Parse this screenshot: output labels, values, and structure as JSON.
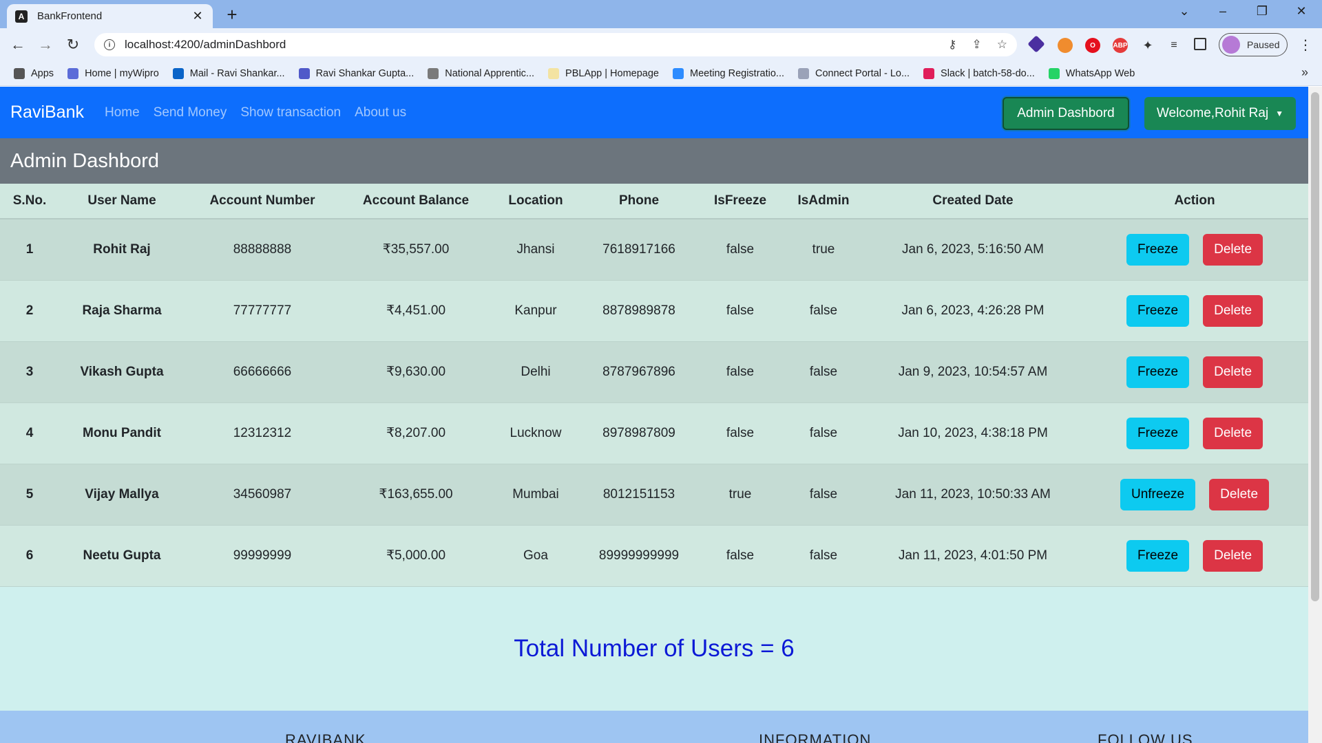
{
  "browser": {
    "tab_title": "BankFrontend",
    "tab_favicon": "A",
    "url": "localhost:4200/adminDashbord",
    "profile_status": "Paused",
    "bookmarks": [
      {
        "label": "Apps",
        "icon": "apps-grid-icon",
        "color": "#555555"
      },
      {
        "label": "Home | myWipro",
        "icon": "wipro-icon",
        "color": "#5b6cd8"
      },
      {
        "label": "Mail - Ravi Shankar...",
        "icon": "outlook-icon",
        "color": "#0a64c8"
      },
      {
        "label": "Ravi Shankar Gupta...",
        "icon": "teams-icon",
        "color": "#5059c9"
      },
      {
        "label": "National Apprentic...",
        "icon": "apprentice-icon",
        "color": "#7a7a7a"
      },
      {
        "label": "PBLApp | Homepage",
        "icon": "pbl-icon",
        "color": "#f3e3a2"
      },
      {
        "label": "Meeting Registratio...",
        "icon": "zoom-icon",
        "color": "#2d8cff"
      },
      {
        "label": "Connect Portal - Lo...",
        "icon": "wipro-icon",
        "color": "#9aa2b8"
      },
      {
        "label": "Slack | batch-58-do...",
        "icon": "slack-icon",
        "color": "#e01e5a"
      },
      {
        "label": "WhatsApp Web",
        "icon": "whatsapp-icon",
        "color": "#25d366"
      }
    ]
  },
  "navbar": {
    "brand": "RaviBank",
    "links": [
      "Home",
      "Send Money",
      "Show transaction",
      "About us"
    ],
    "admin_button": "Admin Dashbord",
    "welcome_button": "Welcome,Rohit Raj"
  },
  "dashboard": {
    "title": "Admin Dashbord",
    "columns": [
      "S.No.",
      "User Name",
      "Account Number",
      "Account Balance",
      "Location",
      "Phone",
      "IsFreeze",
      "IsAdmin",
      "Created Date",
      "Action"
    ],
    "rows": [
      {
        "sno": "1",
        "name": "Rohit Raj",
        "account": "88888888",
        "balance": "₹35,557.00",
        "location": "Jhansi",
        "phone": "7618917166",
        "is_freeze": "false",
        "is_admin": "true",
        "created": "Jan 6, 2023, 5:16:50 AM",
        "freeze_label": "Freeze",
        "delete_label": "Delete"
      },
      {
        "sno": "2",
        "name": "Raja Sharma",
        "account": "77777777",
        "balance": "₹4,451.00",
        "location": "Kanpur",
        "phone": "8878989878",
        "is_freeze": "false",
        "is_admin": "false",
        "created": "Jan 6, 2023, 4:26:28 PM",
        "freeze_label": "Freeze",
        "delete_label": "Delete"
      },
      {
        "sno": "3",
        "name": "Vikash Gupta",
        "account": "66666666",
        "balance": "₹9,630.00",
        "location": "Delhi",
        "phone": "8787967896",
        "is_freeze": "false",
        "is_admin": "false",
        "created": "Jan 9, 2023, 10:54:57 AM",
        "freeze_label": "Freeze",
        "delete_label": "Delete"
      },
      {
        "sno": "4",
        "name": "Monu Pandit",
        "account": "12312312",
        "balance": "₹8,207.00",
        "location": "Lucknow",
        "phone": "8978987809",
        "is_freeze": "false",
        "is_admin": "false",
        "created": "Jan 10, 2023, 4:38:18 PM",
        "freeze_label": "Freeze",
        "delete_label": "Delete"
      },
      {
        "sno": "5",
        "name": "Vijay Mallya",
        "account": "34560987",
        "balance": "₹163,655.00",
        "location": "Mumbai",
        "phone": "8012151153",
        "is_freeze": "true",
        "is_admin": "false",
        "created": "Jan 11, 2023, 10:50:33 AM",
        "freeze_label": "Unfreeze",
        "delete_label": "Delete"
      },
      {
        "sno": "6",
        "name": "Neetu Gupta",
        "account": "99999999",
        "balance": "₹5,000.00",
        "location": "Goa",
        "phone": "89999999999",
        "is_freeze": "false",
        "is_admin": "false",
        "created": "Jan 11, 2023, 4:01:50 PM",
        "freeze_label": "Freeze",
        "delete_label": "Delete"
      }
    ],
    "total_text": "Total Number of Users = 6"
  },
  "footer": {
    "headings": [
      "RAVIBANK",
      "INFORMATION",
      "FOLLOW US"
    ]
  },
  "colors": {
    "primary": "#0d6efd",
    "success": "#198754",
    "info": "#0dcaf0",
    "danger": "#dc3545",
    "header_gray": "#6c757d",
    "total_text": "#0c19d6"
  }
}
